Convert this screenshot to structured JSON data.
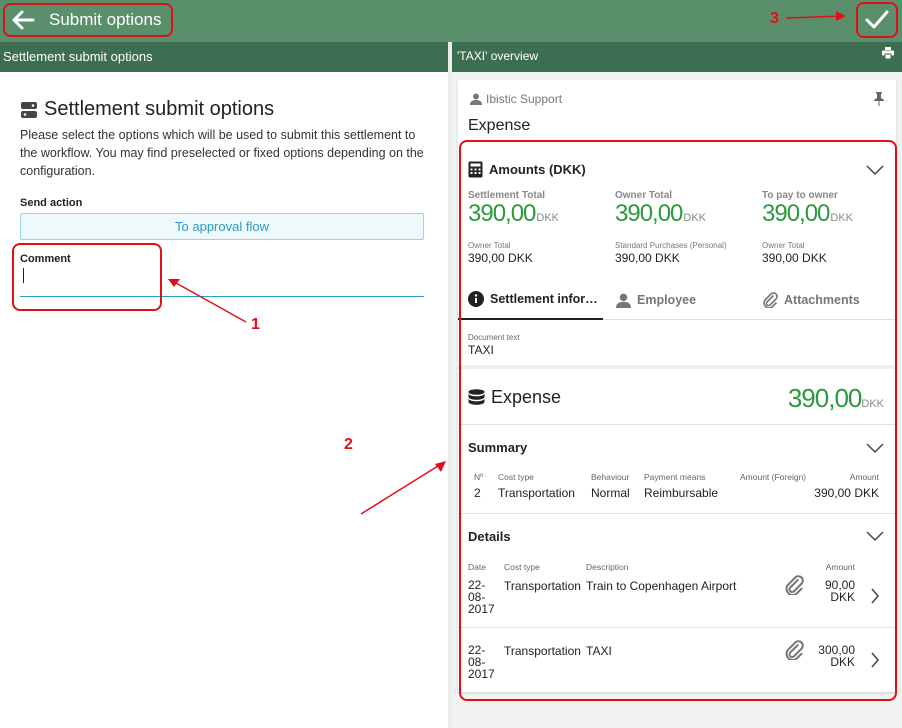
{
  "header": {
    "title": "Submit options",
    "back_icon": "arrow-left-icon",
    "confirm_icon": "checkmark-icon"
  },
  "annotations": {
    "n1": "1",
    "n2": "2",
    "n3": "3"
  },
  "left": {
    "subtitle": "Settlement submit options",
    "heading": "Settlement submit options",
    "description": "Please select the options which will be used to submit this settlement to the workflow. You may find preselected or fixed options depending on the configuration.",
    "send_action_label": "Send action",
    "send_action_value": "To approval flow",
    "comment_label": "Comment",
    "comment_value": ""
  },
  "right": {
    "subtitle": "'TAXI' overview",
    "company": "Ibistic Support",
    "title": "Expense",
    "amounts": {
      "title": "Amounts (DKK)",
      "cols": [
        {
          "label": "Settlement Total",
          "value": "390,00",
          "currency": "DKK",
          "sub_label": "Owner Total",
          "sub_value": "390,00 DKK"
        },
        {
          "label": "Owner Total",
          "value": "390,00",
          "currency": "DKK",
          "sub_label": "Standard Purchases (Personal)",
          "sub_value": "390,00 DKK"
        },
        {
          "label": "To pay to owner",
          "value": "390,00",
          "currency": "DKK",
          "sub_label": "Owner Total",
          "sub_value": "390,00 DKK"
        }
      ]
    },
    "tabs": [
      {
        "label": "Settlement infor…",
        "icon": "info-icon"
      },
      {
        "label": "Employee",
        "icon": "person-icon"
      },
      {
        "label": "Attachments",
        "icon": "paperclip-icon"
      }
    ],
    "document_text_label": "Document text",
    "document_text_value": "TAXI",
    "expense": {
      "title": "Expense",
      "total": "390,00",
      "currency": "DKK"
    },
    "summary": {
      "title": "Summary",
      "headers": [
        "Nº",
        "Cost type",
        "Behaviour",
        "Payment means",
        "Amount (Foreign)",
        "Amount"
      ],
      "rows": [
        [
          "2",
          "Transportation",
          "Normal",
          "Reimbursable",
          "",
          "390,00 DKK"
        ]
      ]
    },
    "details": {
      "title": "Details",
      "headers": [
        "Date",
        "Cost type",
        "Description",
        "Amount"
      ],
      "rows": [
        {
          "date": "22-\n08-\n2017",
          "cost_type": "Transportation",
          "description": "Train to Copenhagen Airport",
          "amount": "90,00",
          "currency": "DKK"
        },
        {
          "date": "22-\n08-\n2017",
          "cost_type": "Transportation",
          "description": "TAXI",
          "amount": "300,00",
          "currency": "DKK"
        }
      ]
    }
  },
  "colors": {
    "header_green": "#5a8f6b",
    "subbar_green": "#3e6e52",
    "amount_green": "#2c9a3c",
    "link_blue": "#2a9dc3",
    "annotation_red": "#e0101a"
  }
}
